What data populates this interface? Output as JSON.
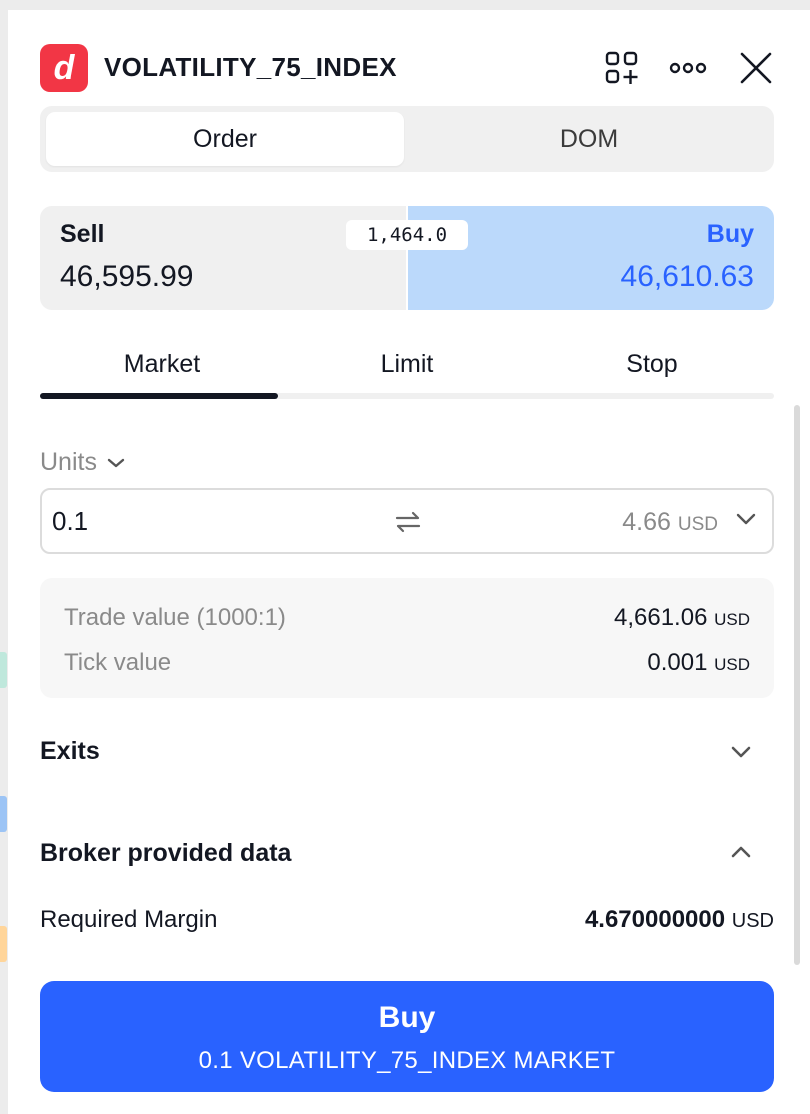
{
  "colors": {
    "brand_red": "#f23645",
    "buy_blue": "#2962ff",
    "buy_bg": "#bbd9fb",
    "sell_bg": "#f0f0f0",
    "edge_teal": "#bfe8dc",
    "edge_blue": "#9cc4f5",
    "edge_orange": "#ffd59a"
  },
  "header": {
    "logo_letter": "d",
    "symbol": "VOLATILITY_75_INDEX",
    "icons": [
      "add-layout-icon",
      "more-icon",
      "close-icon"
    ]
  },
  "mode_tabs": [
    {
      "label": "Order",
      "active": true
    },
    {
      "label": "DOM",
      "active": false
    }
  ],
  "quote": {
    "sell_label": "Sell",
    "sell_price": "46,595.99",
    "spread": "1,464.0",
    "buy_label": "Buy",
    "buy_price": "46,610.63"
  },
  "order_types": [
    {
      "label": "Market",
      "active": true
    },
    {
      "label": "Limit",
      "active": false
    },
    {
      "label": "Stop",
      "active": false
    }
  ],
  "units": {
    "label": "Units",
    "value": "0.1",
    "amount": "4.66",
    "currency": "USD"
  },
  "info": {
    "trade_value_label": "Trade value (1000:1)",
    "trade_value": "4,661.06",
    "trade_value_currency": "USD",
    "tick_value_label": "Tick value",
    "tick_value": "0.001",
    "tick_value_currency": "USD"
  },
  "exits": {
    "title": "Exits",
    "expanded": false
  },
  "broker": {
    "title": "Broker provided data",
    "expanded": true,
    "required_margin_label": "Required Margin",
    "required_margin_value": "4.670000000",
    "required_margin_currency": "USD"
  },
  "submit": {
    "title": "Buy",
    "subtitle": "0.1 VOLATILITY_75_INDEX MARKET"
  }
}
